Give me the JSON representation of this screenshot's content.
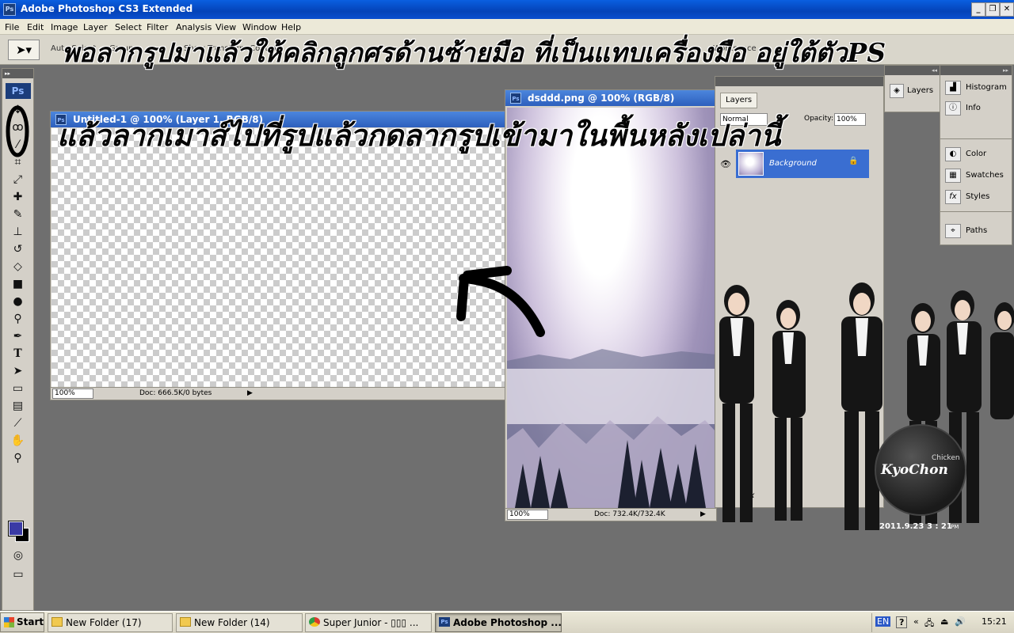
{
  "window": {
    "title": "Adobe Photoshop CS3 Extended",
    "app_icon": "Ps"
  },
  "menu": [
    "File",
    "Edit",
    "Image",
    "Layer",
    "Select",
    "Filter",
    "Analysis",
    "View",
    "Window",
    "Help"
  ],
  "options_bar": {
    "auto_select": "Auto Select",
    "group": "Group",
    "transform_controls": "Show Transform Controls",
    "workspace": "Workspace"
  },
  "toolbox": {
    "logo": "Ps"
  },
  "untitled_doc": {
    "title": "Untitled-1 @ 100% (Layer 1, RGB/8)",
    "zoom": "100%",
    "doc_info": "Doc: 666.5K/0 bytes"
  },
  "dsddd_doc": {
    "title": "dsddd.png @ 100% (RGB/8)",
    "zoom": "100%",
    "doc_info": "Doc: 732.4K/732.4K"
  },
  "layers_panel": {
    "tabs": [
      "Layers"
    ],
    "blend_mode": "Normal",
    "opacity_label": "Opacity:",
    "opacity_value": "100%",
    "layer_name": "Background",
    "fx": "fx"
  },
  "dock": {
    "layers": "Layers",
    "items": [
      "Histogram",
      "Info",
      "Color",
      "Swatches",
      "Styles",
      "Paths"
    ]
  },
  "annotations": {
    "line1": "พอลากรูปมาแล้วให้คลิกลูกศรด้านซ้ายมือ ที่เป็นแทบเครื่องมือ อยู่ใต้ตัวPS",
    "line2": "แล้วลากเมาส์ไปที่รูปแล้วกดลากรูปเข้ามาในพื้นหลังเปล่านี้"
  },
  "clock_widget": {
    "brand_top": "Chicken",
    "brand": "KyoChon",
    "date": "2011.9.23",
    "time": "3 : 21",
    "ampm": "PM"
  },
  "taskbar": {
    "start": "Start",
    "tasks": [
      {
        "label": "New Folder (17)",
        "icon": "folder-icon"
      },
      {
        "label": "New Folder (14)",
        "icon": "folder-icon"
      },
      {
        "label": "Super Junior - ▯▯▯ ...",
        "icon": "chrome-icon"
      },
      {
        "label": "Adobe Photoshop ...",
        "icon": "photoshop-icon"
      }
    ],
    "tray": {
      "lang": "EN",
      "help": "?",
      "time": "15:21"
    }
  }
}
